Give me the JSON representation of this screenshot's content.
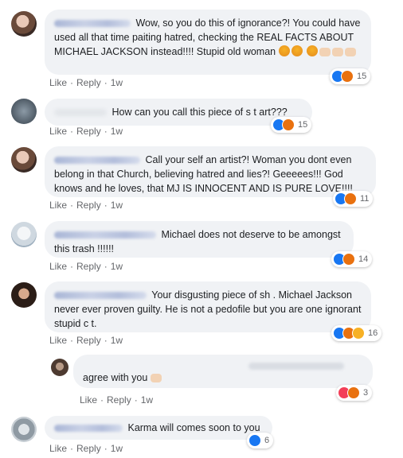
{
  "colors": {
    "bubble": "#f0f2f5",
    "like": "#1877f2",
    "angry": "#e9710f",
    "love": "#f33e58",
    "haha": "#f7b125"
  },
  "actions": {
    "like": "Like",
    "reply": "Reply",
    "sep": "·"
  },
  "comments": [
    {
      "text": "Wow, so you do this of ignorance?! You could have used all that time paiting hatred, checking the REAL FACTS ABOUT MICHAEL JACKSON instead!!!! Stupid old woman",
      "time": "1w",
      "reactions": [
        "like",
        "angry"
      ],
      "count": "15"
    },
    {
      "text": "How can you call this piece of s t art???",
      "time": "1w",
      "reactions": [
        "like",
        "angry"
      ],
      "count": "15"
    },
    {
      "text": "Call your self an artist?! Woman you dont even belong in that Church, believing hatred and lies?! Geeeees!!! God knows and he loves, that MJ IS INNOCENT AND IS PURE LOVE!!!!",
      "time": "1w",
      "reactions": [
        "like",
        "angry"
      ],
      "count": "11"
    },
    {
      "text": "Michael does not deserve to be amongst this trash !!!!!!",
      "time": "1w",
      "reactions": [
        "like",
        "angry"
      ],
      "count": "14"
    },
    {
      "text": "Your disgusting piece of sh . Michael Jackson never ever proven guilty. He is not a pedofile but you are one ignorant stupid c t.",
      "time": "1w",
      "reactions": [
        "like",
        "angry",
        "haha"
      ],
      "count": "16"
    },
    {
      "text": "agree with you",
      "time": "1w",
      "reactions": [
        "love",
        "angry"
      ],
      "count": "3"
    },
    {
      "text": "Karma will comes soon to you",
      "time": "1w",
      "reactions": [
        "like"
      ],
      "count": "6"
    }
  ]
}
